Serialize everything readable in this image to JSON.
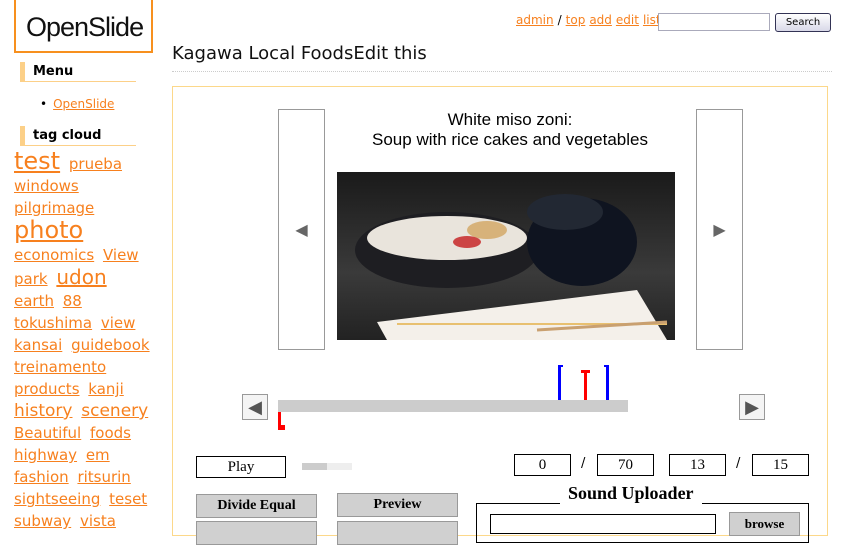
{
  "logo": "OpenSlide",
  "sidebar": {
    "menu_title": "Menu",
    "menu_items": [
      "OpenSlide"
    ],
    "tag_title": "tag cloud",
    "tags": [
      {
        "t": "test",
        "s": 24
      },
      {
        "t": "prueba",
        "s": 15
      },
      {
        "t": "windows",
        "s": 15
      },
      {
        "t": "pilgrimage",
        "s": 15
      },
      {
        "t": "photo",
        "s": 24
      },
      {
        "t": "economics",
        "s": 15
      },
      {
        "t": "View",
        "s": 15
      },
      {
        "t": "park",
        "s": 15
      },
      {
        "t": "udon",
        "s": 20
      },
      {
        "t": "earth",
        "s": 15
      },
      {
        "t": "88",
        "s": 15
      },
      {
        "t": "tokushima",
        "s": 15
      },
      {
        "t": "view",
        "s": 15
      },
      {
        "t": "kansai",
        "s": 15
      },
      {
        "t": "guidebook",
        "s": 15
      },
      {
        "t": "treinamento",
        "s": 15
      },
      {
        "t": "products",
        "s": 15
      },
      {
        "t": "kanji",
        "s": 15
      },
      {
        "t": "history",
        "s": 17
      },
      {
        "t": "scenery",
        "s": 17
      },
      {
        "t": "Beautiful",
        "s": 15
      },
      {
        "t": "foods",
        "s": 15
      },
      {
        "t": "highway",
        "s": 15
      },
      {
        "t": "em",
        "s": 15
      },
      {
        "t": "fashion",
        "s": 15
      },
      {
        "t": "ritsurin",
        "s": 15
      },
      {
        "t": "sightseeing",
        "s": 15
      },
      {
        "t": "teset",
        "s": 15
      },
      {
        "t": "subway",
        "s": 15
      },
      {
        "t": "vista",
        "s": 15
      }
    ]
  },
  "topnav": {
    "admin": "admin",
    "sep": "/",
    "top": "top",
    "add": "add",
    "edit": "edit",
    "list": "list",
    "search_value": "",
    "search_button": "Search"
  },
  "page_title": "Kagawa Local FoodsEdit this",
  "slide": {
    "title": "White miso zoni:\nSoup with rice cakes and vegetables",
    "prev": "◀",
    "next": "▶"
  },
  "controls": {
    "play": "Play",
    "current_time": "0",
    "total_time": "70",
    "current_slide": "13",
    "total_slides": "15",
    "sep": "/",
    "divide_equal": "Divide Equal",
    "preview": "Preview",
    "sound_uploader": "Sound Uploader",
    "browse": "browse",
    "progress": 0.5
  },
  "colors": {
    "accent": "#f7801e",
    "marker_blue": "#0000ff",
    "marker_red": "#ff0000"
  }
}
